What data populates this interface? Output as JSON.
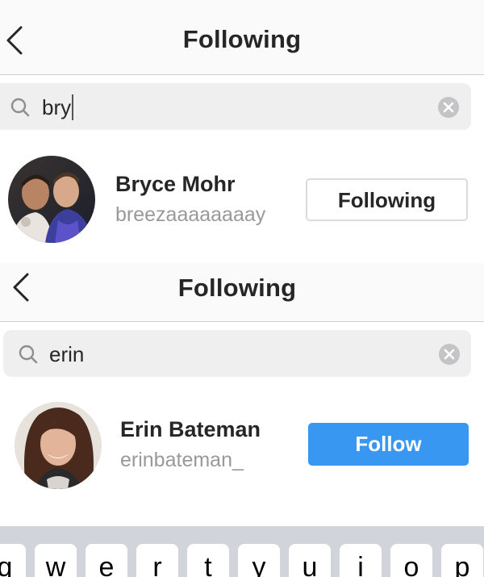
{
  "panel_top": {
    "nav": {
      "title": "Following",
      "back_icon": "chevron-left-icon"
    },
    "search": {
      "query": "bry",
      "search_icon": "search-icon",
      "clear_icon": "clear-circle-icon"
    },
    "user": {
      "name": "Bryce Mohr",
      "handle": "breezaaaaaaaay",
      "button_label": "Following"
    }
  },
  "panel_bottom": {
    "nav": {
      "title": "Following",
      "back_icon": "chevron-left-icon"
    },
    "search": {
      "query": "erin",
      "search_icon": "search-icon",
      "clear_icon": "clear-circle-icon"
    },
    "user": {
      "name": "Erin Bateman",
      "handle": "erinbateman_",
      "button_label": "Follow"
    }
  },
  "keyboard": {
    "keys": [
      "q",
      "w",
      "e",
      "r",
      "t",
      "y",
      "u",
      "i",
      "o",
      "p"
    ]
  },
  "colors": {
    "follow_blue": "#3897f0",
    "text_primary": "#262626",
    "text_secondary": "#999999",
    "search_bg": "#efeff0",
    "keyboard_bg": "#d1d5db"
  }
}
